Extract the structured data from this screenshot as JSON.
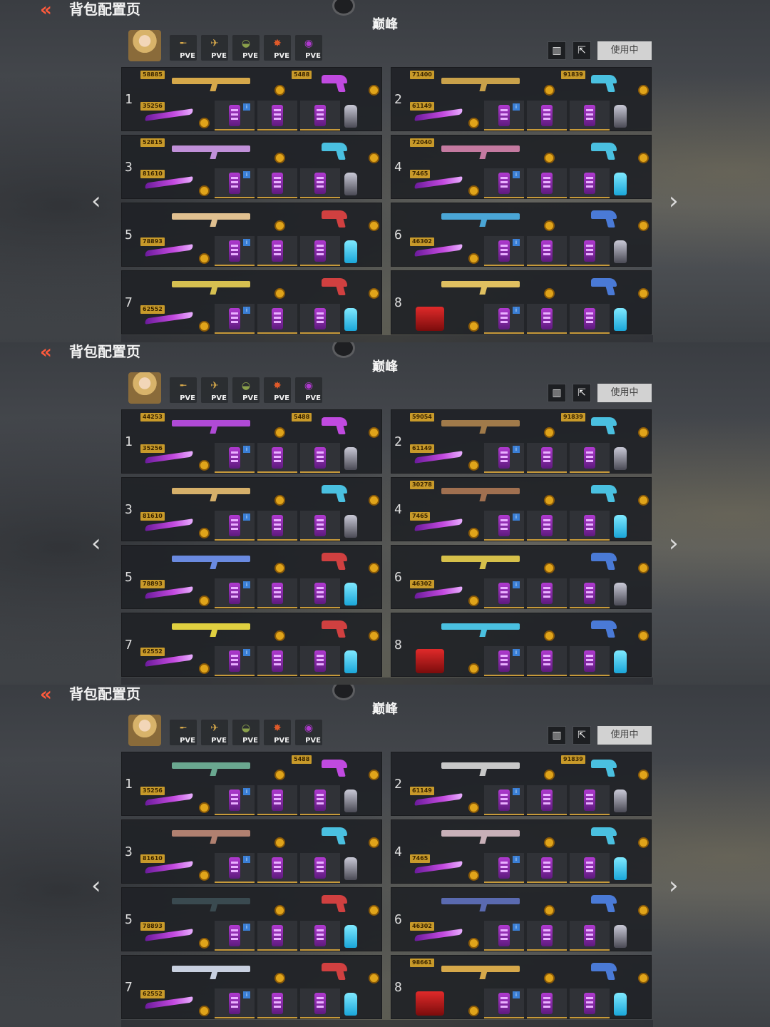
{
  "header": {
    "back_icon": "double-chevron-left-icon",
    "title": "背包配置页",
    "mode": "巅峰"
  },
  "pve_chips": [
    {
      "label": "PVE",
      "icon": "gun-icon"
    },
    {
      "label": "PVE",
      "icon": "gun-icon"
    },
    {
      "label": "PVE",
      "icon": "helmet-icon"
    },
    {
      "label": "PVE",
      "icon": "flame-gun-icon"
    },
    {
      "label": "PVE",
      "icon": "grenade-icon"
    }
  ],
  "toolbar": {
    "stats_icon": "bar-chart-icon",
    "share_icon": "share-icon",
    "in_use_label": "使用中"
  },
  "colors": {
    "accent": "#ff5a3c",
    "gold": "#e0a41a",
    "purple": "#b03ad0",
    "panel_bg": "#202226"
  },
  "panels": [
    {
      "loadouts": [
        {
          "slot": "1",
          "primary_value": "58885",
          "secondary_value": "5488",
          "melee_value": "35256",
          "primary_color": "#d6a84a",
          "throwable": "grey"
        },
        {
          "slot": "2",
          "primary_value": "71400",
          "secondary_value": "91839",
          "melee_value": "61149",
          "primary_color": "#c9a14a",
          "throwable": "grey"
        },
        {
          "slot": "3",
          "primary_value": "52815",
          "secondary_value": "",
          "melee_value": "81610",
          "primary_color": "#c090d8",
          "throwable": "grey"
        },
        {
          "slot": "4",
          "primary_value": "72040",
          "secondary_value": "",
          "melee_value": "7465",
          "primary_color": "#c47aa0",
          "throwable": "blue"
        },
        {
          "slot": "5",
          "primary_value": "",
          "secondary_value": "",
          "melee_value": "78893",
          "primary_color": "#e0c090",
          "throwable": "blue"
        },
        {
          "slot": "6",
          "primary_value": "",
          "secondary_value": "",
          "melee_value": "46302",
          "primary_color": "#4aa6d6",
          "throwable": "grey"
        },
        {
          "slot": "7",
          "primary_value": "",
          "secondary_value": "",
          "melee_value": "62552",
          "primary_color": "#d6c050",
          "throwable": "blue"
        },
        {
          "slot": "8",
          "primary_value": "",
          "secondary_value": "",
          "melee_value": "",
          "primary_color": "#e0c060",
          "throwable": "blue"
        }
      ]
    },
    {
      "loadouts": [
        {
          "slot": "1",
          "primary_value": "44253",
          "secondary_value": "5488",
          "melee_value": "35256",
          "primary_color": "#b04ad6",
          "throwable": "grey"
        },
        {
          "slot": "2",
          "primary_value": "59054",
          "secondary_value": "91839",
          "melee_value": "61149",
          "primary_color": "#a07a4a",
          "throwable": "grey"
        },
        {
          "slot": "3",
          "primary_value": "",
          "secondary_value": "",
          "melee_value": "81610",
          "primary_color": "#d6b06a",
          "throwable": "grey"
        },
        {
          "slot": "4",
          "primary_value": "30278",
          "secondary_value": "",
          "melee_value": "7465",
          "primary_color": "#a07050",
          "throwable": "blue"
        },
        {
          "slot": "5",
          "primary_value": "",
          "secondary_value": "",
          "melee_value": "78893",
          "primary_color": "#6a8ae0",
          "throwable": "blue"
        },
        {
          "slot": "6",
          "primary_value": "",
          "secondary_value": "",
          "melee_value": "46302",
          "primary_color": "#d6c04a",
          "throwable": "grey"
        },
        {
          "slot": "7",
          "primary_value": "",
          "secondary_value": "",
          "melee_value": "62552",
          "primary_color": "#e0d040",
          "throwable": "blue"
        },
        {
          "slot": "8",
          "primary_value": "",
          "secondary_value": "",
          "melee_value": "",
          "primary_color": "#4ac0e0",
          "throwable": "blue"
        }
      ]
    },
    {
      "loadouts": [
        {
          "slot": "1",
          "primary_value": "",
          "secondary_value": "5488",
          "melee_value": "35256",
          "primary_color": "#6aa890",
          "throwable": "grey"
        },
        {
          "slot": "2",
          "primary_value": "",
          "secondary_value": "91839",
          "melee_value": "61149",
          "primary_color": "#c8c8c8",
          "throwable": "grey"
        },
        {
          "slot": "3",
          "primary_value": "",
          "secondary_value": "",
          "melee_value": "81610",
          "primary_color": "#b08070",
          "throwable": "grey"
        },
        {
          "slot": "4",
          "primary_value": "",
          "secondary_value": "",
          "melee_value": "7465",
          "primary_color": "#c8b0b8",
          "throwable": "blue"
        },
        {
          "slot": "5",
          "primary_value": "",
          "secondary_value": "",
          "melee_value": "78893",
          "primary_color": "#3a4a50",
          "throwable": "blue"
        },
        {
          "slot": "6",
          "primary_value": "",
          "secondary_value": "",
          "melee_value": "46302",
          "primary_color": "#5a6ab0",
          "throwable": "grey"
        },
        {
          "slot": "7",
          "primary_value": "",
          "secondary_value": "",
          "melee_value": "62552",
          "primary_color": "#c8d0e0",
          "throwable": "blue"
        },
        {
          "slot": "8",
          "primary_value": "98661",
          "secondary_value": "",
          "melee_value": "",
          "primary_color": "#d6a84a",
          "throwable": "blue"
        }
      ]
    }
  ]
}
